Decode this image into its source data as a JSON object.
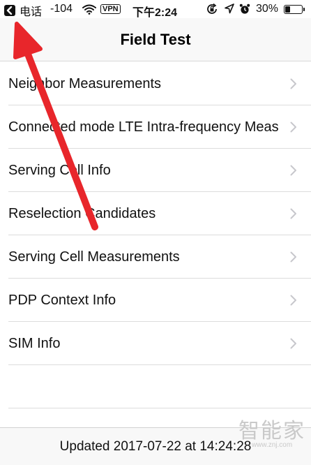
{
  "status_bar": {
    "back_app_label": "电话",
    "signal_strength": "-104",
    "vpn_label": "VPN",
    "time": "下午2:24",
    "battery_percent": "30%",
    "battery_level": 0.3,
    "icons": [
      "back-icon",
      "wifi-icon",
      "rotation-lock-icon",
      "location-icon",
      "alarm-icon",
      "battery-icon"
    ]
  },
  "nav": {
    "title": "Field Test"
  },
  "list": {
    "items": [
      {
        "label": "Neighbor Measurements"
      },
      {
        "label": "Connected mode LTE Intra-frequency Meas"
      },
      {
        "label": "Serving Cell Info"
      },
      {
        "label": "Reselection Candidates"
      },
      {
        "label": "Serving Cell Measurements"
      },
      {
        "label": "PDP Context Info"
      },
      {
        "label": "SIM Info"
      }
    ]
  },
  "footer": {
    "updated_text": "Updated 2017-07-22 at 14:24:28"
  },
  "watermark": {
    "text": "智能家",
    "url": "www.znj.com"
  },
  "colors": {
    "background": "#ffffff",
    "bar_background": "#f8f8f8",
    "separator": "#dcdcdc",
    "chevron": "#c7c7cc",
    "annotation_arrow": "#e8262b"
  }
}
